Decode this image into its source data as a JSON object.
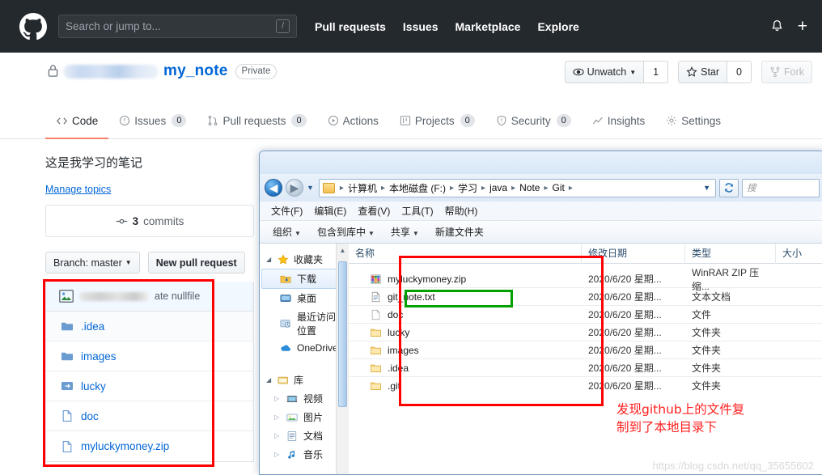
{
  "github": {
    "header": {
      "logo_icon": "github-mark-icon",
      "search_placeholder": "Search or jump to...",
      "search_value": "",
      "search_shortcut": "/",
      "nav": [
        {
          "label": "Pull requests"
        },
        {
          "label": "Issues"
        },
        {
          "label": "Marketplace"
        },
        {
          "label": "Explore"
        }
      ],
      "notification_icon": "bell-icon",
      "create_new_label": "+"
    },
    "repo": {
      "owner_blurred": true,
      "name": "my_note",
      "visibility_badge": "Private",
      "lock_icon": "lock-icon",
      "actions": [
        {
          "name": "unwatch",
          "label": "Unwatch",
          "icon": "eye-icon",
          "count": "1",
          "caret": true
        },
        {
          "name": "star",
          "label": "Star",
          "icon": "star-icon",
          "count": "0",
          "caret": false
        },
        {
          "name": "fork",
          "label": "Fork",
          "icon": "fork-icon",
          "count": "",
          "caret": false
        }
      ],
      "tabs": [
        {
          "label": "Code",
          "count": "",
          "icon": "code-icon",
          "active": true
        },
        {
          "label": "Issues",
          "count": "0",
          "icon": "issue-opened-icon",
          "active": false
        },
        {
          "label": "Pull requests",
          "count": "0",
          "icon": "git-pull-request-icon",
          "active": false
        },
        {
          "label": "Actions",
          "count": "",
          "icon": "play-icon",
          "active": false
        },
        {
          "label": "Projects",
          "count": "0",
          "icon": "project-icon",
          "active": false
        },
        {
          "label": "Security",
          "count": "0",
          "icon": "shield-icon",
          "active": false
        },
        {
          "label": "Insights",
          "count": "",
          "icon": "graph-icon",
          "active": false
        },
        {
          "label": "Settings",
          "count": "",
          "icon": "gear-icon",
          "active": false
        }
      ],
      "description": "这是我学习的笔记",
      "manage_topics": "Manage topics",
      "commits_count": "3",
      "commits_label": "commits",
      "branch_button": "Branch: master",
      "new_pull_request_button": "New pull request",
      "latest_commit": {
        "avatar_icon": "avatar-image-icon",
        "author_blurred": true,
        "message_tail": "ate nullfile"
      },
      "files": [
        {
          "name": ".idea",
          "icon": "folder-icon"
        },
        {
          "name": "images",
          "icon": "folder-icon"
        },
        {
          "name": "lucky",
          "icon": "submodule-icon"
        },
        {
          "name": "doc",
          "icon": "file-icon"
        },
        {
          "name": "myluckymoney.zip",
          "icon": "file-icon"
        }
      ]
    }
  },
  "explorer": {
    "nav": {
      "back_icon": "back-arrow-icon",
      "forward_icon": "forward-arrow-icon",
      "history_caret_icon": "chevron-down-icon",
      "breadcrumbs": [
        "计算机",
        "本地磁盘 (F:)",
        "学习",
        "java",
        "Note",
        "Git"
      ],
      "address_caret_icon": "chevron-down-icon",
      "refresh_icon": "refresh-icon",
      "search_placeholder": "搜"
    },
    "menubar": [
      "文件(F)",
      "编辑(E)",
      "查看(V)",
      "工具(T)",
      "帮助(H)"
    ],
    "toolbar": [
      {
        "label": "组织",
        "caret": true
      },
      {
        "label": "包含到库中",
        "caret": true
      },
      {
        "label": "共享",
        "caret": true
      },
      {
        "label": "新建文件夹",
        "caret": false
      }
    ],
    "sidebar": [
      {
        "label": "收藏夹",
        "icon": "star-icon",
        "group": true,
        "expanded": true
      },
      {
        "label": "下载",
        "icon": "downloads-folder-icon",
        "selected": true
      },
      {
        "label": "桌面",
        "icon": "desktop-icon",
        "selected": false
      },
      {
        "label": "最近访问的位置",
        "icon": "recent-places-icon",
        "selected": false
      },
      {
        "label": "OneDrive",
        "icon": "onedrive-cloud-icon",
        "selected": false
      },
      {
        "label": "库",
        "icon": "library-icon",
        "group": true,
        "expanded": true
      },
      {
        "label": "视频",
        "icon": "video-icon",
        "selected": false,
        "child": true
      },
      {
        "label": "图片",
        "icon": "pictures-icon",
        "selected": false,
        "child": true
      },
      {
        "label": "文档",
        "icon": "documents-icon",
        "selected": false,
        "child": true
      },
      {
        "label": "音乐",
        "icon": "music-icon",
        "selected": false,
        "child": true
      }
    ],
    "columns": [
      "名称",
      "修改日期",
      "类型",
      "大小"
    ],
    "rows": [
      {
        "name": "myluckymoney.zip",
        "date": "2020/6/20 星期...",
        "type": "WinRAR ZIP 压缩...",
        "icon": "winrar-zip-icon"
      },
      {
        "name": "git_note.txt",
        "date": "2020/6/20 星期...",
        "type": "文本文档",
        "icon": "text-file-icon",
        "highlight": "green"
      },
      {
        "name": "doc",
        "date": "2020/6/20 星期...",
        "type": "文件",
        "icon": "generic-file-icon"
      },
      {
        "name": "lucky",
        "date": "2020/6/20 星期...",
        "type": "文件夹",
        "icon": "folder-icon"
      },
      {
        "name": "images",
        "date": "2020/6/20 星期...",
        "type": "文件夹",
        "icon": "folder-icon"
      },
      {
        "name": ".idea",
        "date": "2020/6/20 星期...",
        "type": "文件夹",
        "icon": "folder-icon"
      },
      {
        "name": ".git",
        "date": "2020/6/20 星期...",
        "type": "文件夹",
        "icon": "folder-icon"
      }
    ]
  },
  "annotations": {
    "note_text": "发现github上的文件复\n制到了本地目录下",
    "note_color": "#ff2020",
    "red_box_color": "#ff0000",
    "green_box_color": "#00a000",
    "watermark": "https://blog.csdn.net/qq_35655602"
  }
}
